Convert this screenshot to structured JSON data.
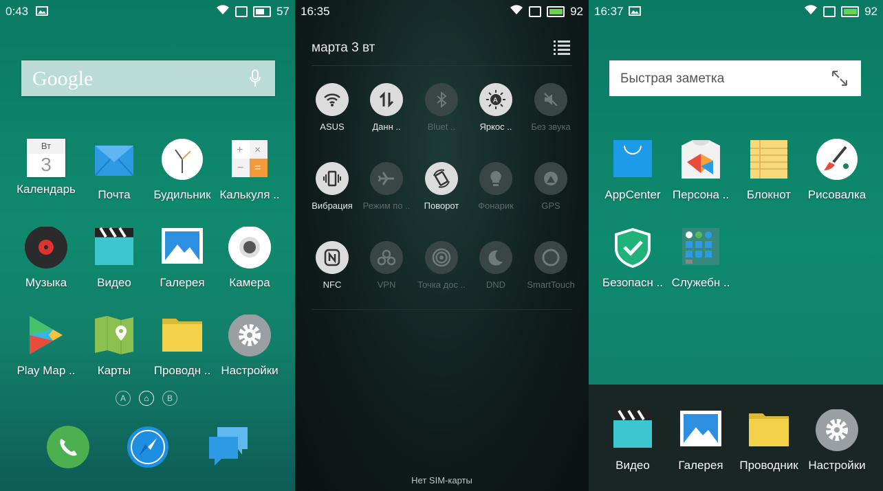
{
  "panel1": {
    "status": {
      "time": "0:43",
      "battery": "57"
    },
    "search": {
      "logo": "Google"
    },
    "apps": [
      {
        "label": "Календарь",
        "day": "Вт",
        "date": "3"
      },
      {
        "label": "Почта"
      },
      {
        "label": "Будильник"
      },
      {
        "label": "Калькуля .."
      },
      {
        "label": "Музыка"
      },
      {
        "label": "Видео"
      },
      {
        "label": "Галерея"
      },
      {
        "label": "Камера"
      },
      {
        "label": "Play Map .."
      },
      {
        "label": "Карты"
      },
      {
        "label": "Проводн .."
      },
      {
        "label": "Настройки"
      }
    ],
    "pager": [
      "A",
      "⌂",
      "B"
    ]
  },
  "panel2": {
    "status": {
      "time": "16:35",
      "battery": "92"
    },
    "date": "марта 3  вт",
    "toggles": [
      {
        "label": "ASUS",
        "on": true
      },
      {
        "label": "Данн ..",
        "on": true
      },
      {
        "label": "Bluet ..",
        "on": false
      },
      {
        "label": "Яркос ..",
        "on": true
      },
      {
        "label": "Без звука",
        "on": false
      },
      {
        "label": "Вибрация",
        "on": true
      },
      {
        "label": "Режим по ..",
        "on": false
      },
      {
        "label": "Поворот",
        "on": true
      },
      {
        "label": "Фонарик",
        "on": false
      },
      {
        "label": "GPS",
        "on": false
      },
      {
        "label": "NFC",
        "on": true
      },
      {
        "label": "VPN",
        "on": false
      },
      {
        "label": "Точка дос ..",
        "on": false
      },
      {
        "label": "DND",
        "on": false
      },
      {
        "label": "SmartTouch",
        "on": false
      }
    ],
    "footer": "Нет SIM-карты"
  },
  "panel3": {
    "status": {
      "time": "16:37",
      "battery": "92"
    },
    "note_placeholder": "Быстрая заметка",
    "apps": [
      {
        "label": "AppCenter"
      },
      {
        "label": "Персона .."
      },
      {
        "label": "Блокнот"
      },
      {
        "label": "Рисовалка"
      },
      {
        "label": "Безопасн .."
      },
      {
        "label": "Служебн .."
      }
    ],
    "dock": [
      {
        "label": "Видео"
      },
      {
        "label": "Галерея"
      },
      {
        "label": "Проводник"
      },
      {
        "label": "Настройки"
      }
    ]
  }
}
